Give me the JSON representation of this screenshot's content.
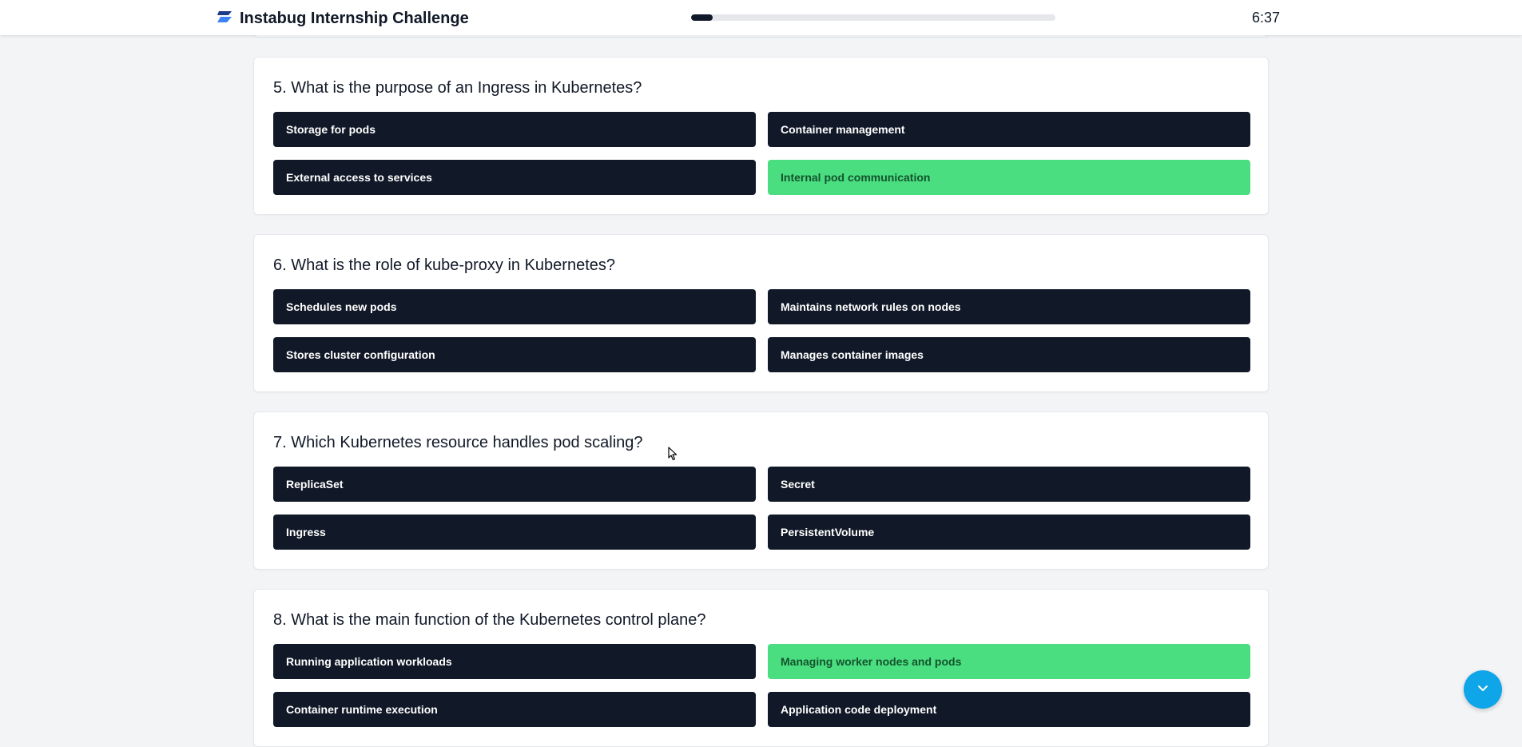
{
  "header": {
    "title": "Instabug Internship Challenge",
    "progress_fraction": 0.06,
    "timer": "6:37",
    "brand_color": "#1e40af"
  },
  "questions": [
    {
      "title": "5. What is the purpose of an Ingress in Kubernetes?",
      "options": [
        {
          "label": "Storage for pods",
          "selected": false
        },
        {
          "label": "Container management",
          "selected": false
        },
        {
          "label": "External access to services",
          "selected": false
        },
        {
          "label": "Internal pod communication",
          "selected": true
        }
      ]
    },
    {
      "title": "6. What is the role of kube-proxy in Kubernetes?",
      "options": [
        {
          "label": "Schedules new pods",
          "selected": false
        },
        {
          "label": "Maintains network rules on nodes",
          "selected": false
        },
        {
          "label": "Stores cluster configuration",
          "selected": false
        },
        {
          "label": "Manages container images",
          "selected": false
        }
      ]
    },
    {
      "title": "7. Which Kubernetes resource handles pod scaling?",
      "options": [
        {
          "label": "ReplicaSet",
          "selected": false
        },
        {
          "label": "Secret",
          "selected": false
        },
        {
          "label": "Ingress",
          "selected": false
        },
        {
          "label": "PersistentVolume",
          "selected": false
        }
      ]
    },
    {
      "title": "8. What is the main function of the Kubernetes control plane?",
      "options": [
        {
          "label": "Running application workloads",
          "selected": false
        },
        {
          "label": "Managing worker nodes and pods",
          "selected": true
        },
        {
          "label": "Container runtime execution",
          "selected": false
        },
        {
          "label": "Application code deployment",
          "selected": false
        }
      ]
    }
  ],
  "colors": {
    "option_bg": "#111827",
    "option_selected_bg": "#4ade80",
    "accent": "#0ea5e9"
  },
  "icons": {
    "brand": "instabug-logo-icon",
    "scroll": "chevron-down-icon",
    "cursor": "mouse-pointer-icon"
  }
}
